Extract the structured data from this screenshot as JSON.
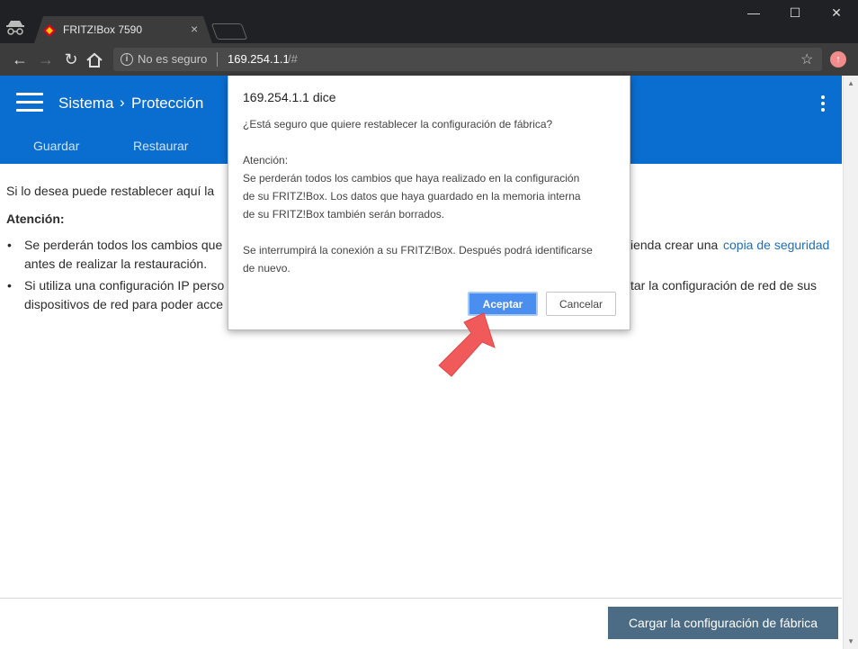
{
  "browser": {
    "tab_title": "FRITZ!Box 7590",
    "tab_close": "×",
    "security_text": "No es seguro",
    "url_host": "169.254.1.1",
    "url_path": "/#",
    "window_controls": [
      "—",
      "☐",
      "✕"
    ]
  },
  "app": {
    "breadcrumb_parent": "Sistema",
    "breadcrumb_child": "Protección",
    "tabs": [
      "Guardar",
      "Restaurar"
    ],
    "accent_color": "#0a6ed1"
  },
  "content": {
    "intro": "Si lo desea puede restablecer aquí la",
    "attention": "Atención:",
    "bullet1_line1_start": "Se perderán todos los cambios que",
    "bullet1_line1_end": "ienda crear una",
    "bullet1_link": "copia de seguridad",
    "bullet1_line2": "antes de realizar la restauración.",
    "bullet2_line1_start": "Si utiliza una configuración IP perso",
    "bullet2_line1_end": "tar la configuración de red de sus",
    "bullet2_line2": "dispositivos de red para poder acce",
    "bullet_marker": "•",
    "factory_button": "Cargar la configuración de fábrica"
  },
  "dialog": {
    "title": "169.254.1.1 dice",
    "question": "¿Está seguro que quiere restablecer la configuración de fábrica?",
    "attention": "Atención:",
    "line1": "Se perderán todos los cambios que haya realizado en la configuración",
    "line2": "de su FRITZ!Box. Los datos que haya guardado en la memoria interna",
    "line3": "de su FRITZ!Box también serán borrados.",
    "line4": "Se interrumpirá la conexión a su FRITZ!Box. Después podrá identificarse",
    "line5": "de nuevo.",
    "accept": "Aceptar",
    "cancel": "Cancelar"
  }
}
